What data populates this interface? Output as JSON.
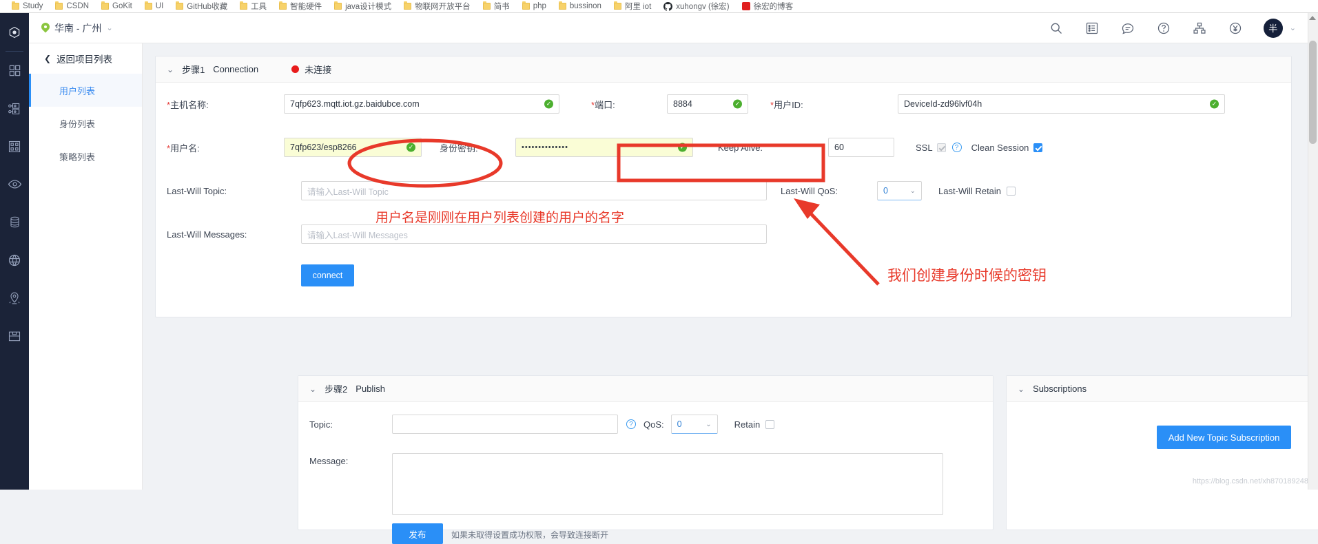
{
  "browser": {
    "bookmarks": [
      {
        "label": "Study",
        "icon": "folder-icon"
      },
      {
        "label": "CSDN",
        "icon": "folder-icon"
      },
      {
        "label": "GoKit",
        "icon": "folder-icon"
      },
      {
        "label": "UI",
        "icon": "folder-icon"
      },
      {
        "label": "GitHub收藏",
        "icon": "folder-icon"
      },
      {
        "label": "工具",
        "icon": "folder-icon"
      },
      {
        "label": "智能硬件",
        "icon": "folder-icon"
      },
      {
        "label": "java设计模式",
        "icon": "folder-icon"
      },
      {
        "label": "物联网开放平台",
        "icon": "folder-icon"
      },
      {
        "label": "简书",
        "icon": "folder-icon"
      },
      {
        "label": "php",
        "icon": "folder-icon"
      },
      {
        "label": "bussinon",
        "icon": "folder-icon"
      },
      {
        "label": "阿里 iot",
        "icon": "folder-icon"
      },
      {
        "label": "xuhongv (徐宏)",
        "icon": "github-icon"
      },
      {
        "label": "徐宏的博客",
        "icon": "csdn-icon"
      }
    ]
  },
  "rail": {
    "items": [
      {
        "icon": "settings-gear-icon"
      },
      {
        "icon": "grid-dashboard-icon"
      },
      {
        "icon": "device-tree-icon"
      },
      {
        "icon": "qr-modules-icon"
      },
      {
        "icon": "eye-visibility-icon"
      },
      {
        "icon": "database-icon"
      },
      {
        "icon": "globe-icon"
      },
      {
        "icon": "location-pin-icon"
      },
      {
        "icon": "archive-box-icon"
      }
    ]
  },
  "topbar": {
    "region_label": "华南 - 广州",
    "region_caret": "⌄",
    "icons": [
      {
        "name": "search-icon"
      },
      {
        "name": "console-list-icon"
      },
      {
        "name": "message-icon"
      },
      {
        "name": "help-icon"
      },
      {
        "name": "org-tree-icon"
      },
      {
        "name": "billing-icon"
      }
    ],
    "avatar_text": "半",
    "avatar_caret": "⌄"
  },
  "sidebar": {
    "back_label": "返回项目列表",
    "back_icon": "chevron-left-icon",
    "items": [
      {
        "label": "用户列表",
        "active": true
      },
      {
        "label": "身份列表",
        "active": false
      },
      {
        "label": "策略列表",
        "active": false
      }
    ]
  },
  "connection": {
    "chevron": "⌄",
    "step_label": "步骤1",
    "title": "Connection",
    "status_text": "未连接",
    "status_color": "#e81b1b",
    "fields": {
      "host_label": "主机名称:",
      "host_value": "7qfp623.mqtt.iot.gz.baidubce.com",
      "port_label": "端口:",
      "port_value": "8884",
      "clientid_label": "用户ID:",
      "clientid_value": "DeviceId-zd96lvf04h",
      "username_label": "用户名:",
      "username_value": "7qfp623/esp8266",
      "password_label": "身份密钥:",
      "password_value": "••••••••••••••",
      "keepalive_label": "Keep Alive:",
      "keepalive_value": "60",
      "ssl_label": "SSL",
      "ssl_checked": true,
      "clean_session_label": "Clean Session",
      "clean_session_checked": true,
      "lw_topic_label": "Last-Will Topic:",
      "lw_topic_placeholder": "请输入Last-Will Topic",
      "lw_qos_label": "Last-Will QoS:",
      "lw_qos_value": "0",
      "lw_retain_label": "Last-Will Retain",
      "lw_retain_checked": false,
      "lw_msg_label": "Last-Will Messages:",
      "lw_msg_placeholder": "请输入Last-Will Messages",
      "connect_button": "connect"
    }
  },
  "publish": {
    "chevron": "⌄",
    "step_label": "步骤2",
    "title": "Publish",
    "topic_label": "Topic:",
    "topic_value": "",
    "qos_label": "QoS:",
    "qos_value": "0",
    "retain_label": "Retain",
    "retain_checked": false,
    "message_label": "Message:",
    "message_value": "",
    "publish_button": "发布",
    "publish_hint": "如果未取得设置成功权限，会导致连接断开"
  },
  "subscriptions": {
    "chevron": "⌄",
    "title": "Subscriptions",
    "add_button": "Add New Topic Subscription"
  },
  "annotations": {
    "username_note": "用户名是刚刚在用户列表创建的用户的名字",
    "password_note": "我们创建身份时候的密钥",
    "color": "#e8392a"
  },
  "watermark": "https://blog.csdn.net/xh870189248"
}
